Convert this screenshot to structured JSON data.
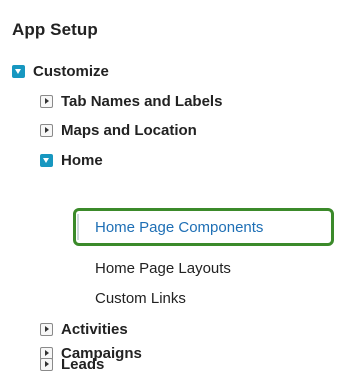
{
  "section_title": "App Setup",
  "tree": {
    "customize": "Customize",
    "tab_names": "Tab Names and Labels",
    "maps": "Maps and Location",
    "home": "Home",
    "home_page_components": "Home Page Components",
    "home_page_layouts": "Home Page Layouts",
    "custom_links": "Custom Links",
    "activities": "Activities",
    "campaigns": "Campaigns",
    "leads": "Leads"
  },
  "colors": {
    "toggle_blue": "#1797c0",
    "link_blue": "#1e6fb5",
    "highlight_green": "#3b8a2a"
  },
  "icons": {
    "expanded": "caret-down-icon",
    "collapsed": "caret-right-icon"
  }
}
